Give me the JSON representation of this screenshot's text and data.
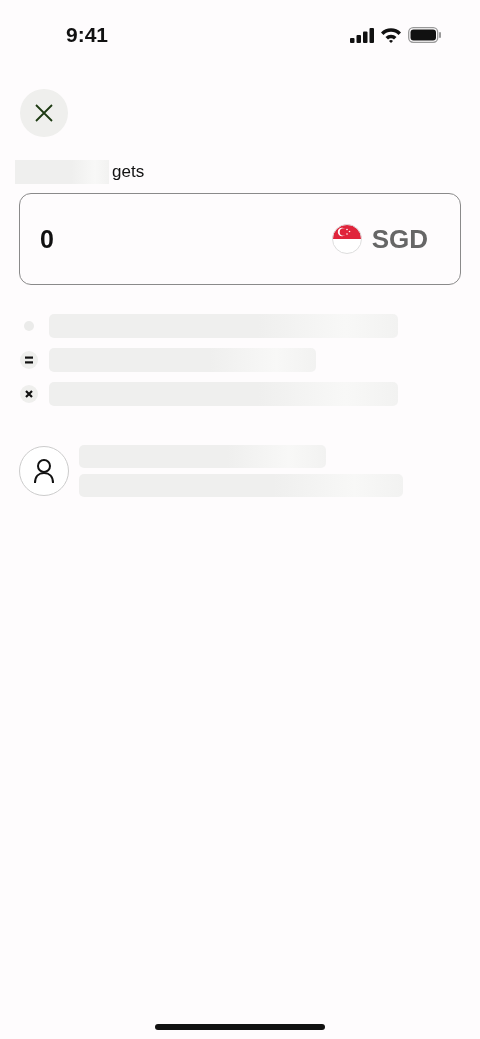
{
  "status_bar": {
    "time": "9:41"
  },
  "recipient_label": {
    "text": "gets"
  },
  "amount_field": {
    "value": "0",
    "currency": "SGD"
  },
  "breakdown": [
    {
      "kind": "dot"
    },
    {
      "kind": "equals"
    },
    {
      "kind": "times"
    }
  ],
  "recipient": {
    "kind": "avatar"
  }
}
